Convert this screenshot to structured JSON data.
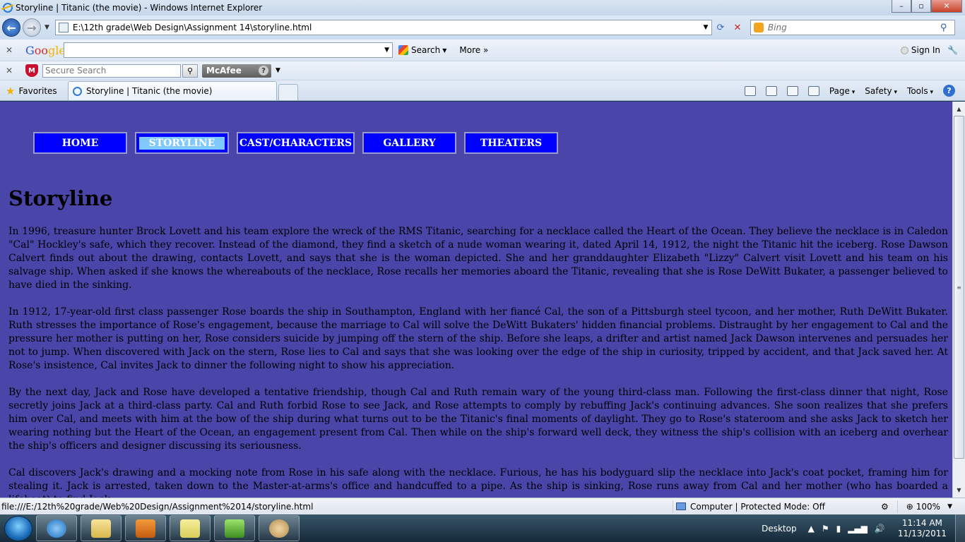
{
  "window": {
    "title": "Storyline | Titanic (the movie) - Windows Internet Explorer",
    "minimize": "–",
    "maximize": "▫",
    "close": "✕"
  },
  "address_bar": {
    "url": "E:\\12th grade\\Web Design\\Assignment 14\\storyline.html",
    "search_placeholder": "Bing"
  },
  "google_toolbar": {
    "brand": [
      "G",
      "oo",
      "gle"
    ],
    "search_label": "Search",
    "more_label": "More »",
    "signin_label": "Sign In"
  },
  "mcafee_toolbar": {
    "search_placeholder": "Secure Search",
    "brand_label": "McAfee",
    "help_label": "?"
  },
  "tabs_bar": {
    "favorites_label": "Favorites",
    "tab_title": "Storyline | Titanic (the movie)",
    "commands": [
      "Page",
      "Safety",
      "Tools"
    ]
  },
  "page": {
    "nav": [
      {
        "label": "HOME",
        "active": false
      },
      {
        "label": "STORYLINE",
        "active": true
      },
      {
        "label": "CAST/CHARACTERS",
        "active": false
      },
      {
        "label": "GALLERY",
        "active": false
      },
      {
        "label": "THEATERS",
        "active": false
      }
    ],
    "heading": "Storyline",
    "paragraphs": [
      "In 1996, treasure hunter Brock Lovett and his team explore the wreck of the RMS Titanic, searching for a necklace called the Heart of the Ocean. They believe the necklace is in Caledon \"Cal\" Hockley's safe, which they recover. Instead of the diamond, they find a sketch of a nude woman wearing it, dated April 14, 1912, the night the Titanic hit the iceberg. Rose Dawson Calvert finds out about the drawing, contacts Lovett, and says that she is the woman depicted. She and her granddaughter Elizabeth \"Lizzy\" Calvert visit Lovett and his team on his salvage ship. When asked if she knows the whereabouts of the necklace, Rose recalls her memories aboard the Titanic, revealing that she is Rose DeWitt Bukater, a passenger believed to have died in the sinking.",
      "In 1912, 17-year-old first class passenger Rose boards the ship in Southampton, England with her fiancé Cal, the son of a Pittsburgh steel tycoon, and her mother, Ruth DeWitt Bukater. Ruth stresses the importance of Rose's engagement, because the marriage to Cal will solve the DeWitt Bukaters' hidden financial problems. Distraught by her engagement to Cal and the pressure her mother is putting on her, Rose considers suicide by jumping off the stern of the ship. Before she leaps, a drifter and artist named Jack Dawson intervenes and persuades her not to jump. When discovered with Jack on the stern, Rose lies to Cal and says that she was looking over the edge of the ship in curiosity, tripped by accident, and that Jack saved her. At Rose's insistence, Cal invites Jack to dinner the following night to show his appreciation.",
      "By the next day, Jack and Rose have developed a tentative friendship, though Cal and Ruth remain wary of the young third-class man. Following the first-class dinner that night, Rose secretly joins Jack at a third-class party. Cal and Ruth forbid Rose to see Jack, and Rose attempts to comply by rebuffing Jack's continuing advances. She soon realizes that she prefers him over Cal, and meets with him at the bow of the ship during what turns out to be the Titanic's final moments of daylight. They go to Rose's stateroom and she asks Jack to sketch her wearing nothing but the Heart of the Ocean, an engagement present from Cal. Then while on the ship's forward well deck, they witness the ship's collision with an iceberg and overhear the ship's officers and designer discussing its seriousness.",
      "Cal discovers Jack's drawing and a mocking note from Rose in his safe along with the necklace. Furious, he has his bodyguard slip the necklace into Jack's coat pocket, framing him for stealing it. Jack is arrested, taken down to the Master-at-arms's office and handcuffed to a pipe. As the ship is sinking, Rose runs away from Cal and her mother (who has boarded a lifeboat) to find Jack."
    ]
  },
  "status_bar": {
    "url": "file:///E:/12th%20grade/Web%20Design/Assignment%2014/storyline.html",
    "zone": "Computer | Protected Mode: Off",
    "zoom": "100%"
  },
  "taskbar": {
    "desktop_label": "Desktop",
    "time": "11:14 AM",
    "date": "11/13/2011"
  },
  "colors": {
    "page_background": "#4a46a9",
    "nav_button": "#0000ff",
    "nav_active_highlight": "#7fc9ff"
  }
}
